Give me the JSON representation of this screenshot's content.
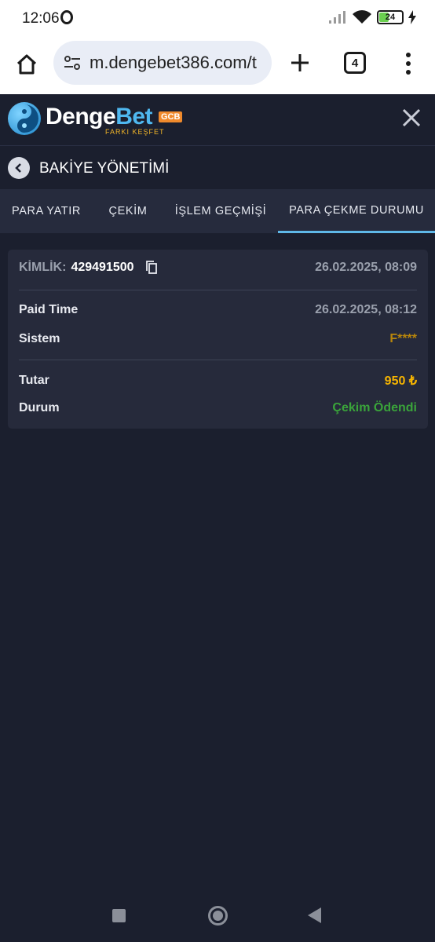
{
  "status_bar": {
    "time": "12:06",
    "battery": "24",
    "icons": [
      "opera-icon",
      "signal-icon",
      "wifi-icon",
      "battery-icon",
      "charging-icon"
    ]
  },
  "browser": {
    "url": "m.dengebet386.com/t",
    "tab_count": "4",
    "icons": [
      "home-icon",
      "site-settings-icon",
      "new-tab-icon",
      "tabs-icon",
      "menu-icon"
    ]
  },
  "header": {
    "logo_main": "Denge",
    "logo_accent": "Bet",
    "logo_badge": "GCB",
    "tagline": "FARKI KEŞFET"
  },
  "page": {
    "title": "BAKİYE YÖNETİMİ"
  },
  "tabs": [
    {
      "label": "PARA YATIR"
    },
    {
      "label": "ÇEKİM"
    },
    {
      "label": "İŞLEM GEÇMİŞİ"
    },
    {
      "label": "PARA ÇEKME DURUMU",
      "active": true
    }
  ],
  "card": {
    "id_label": "KİMLİK:",
    "id_value": "429491500",
    "created": "26.02.2025, 08:09",
    "paid_time_label": "Paid Time",
    "paid_time_value": "26.02.2025, 08:12",
    "system_label": "Sistem",
    "system_value": "F****",
    "amount_label": "Tutar",
    "amount_value": "950 ₺",
    "status_label": "Durum",
    "status_value": "Çekim Ödendi"
  },
  "colors": {
    "background": "#1b1f2e",
    "card": "#262a3b",
    "accent": "#5fb8e8",
    "amount": "#f7b500",
    "status_paid": "#3aa43a",
    "system": "#b8860b"
  }
}
